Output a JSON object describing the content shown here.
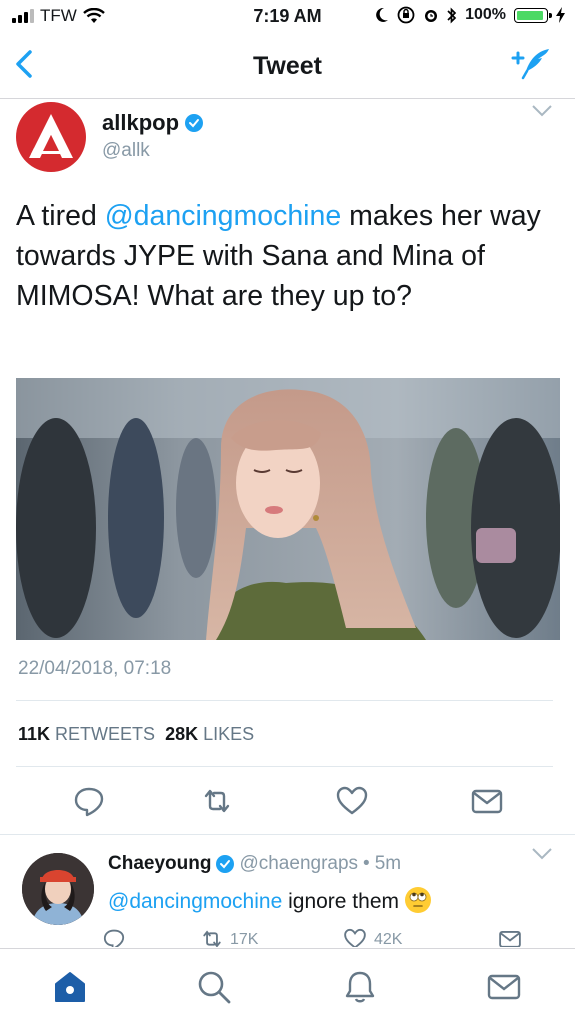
{
  "status_bar": {
    "carrier": "TFW",
    "time": "7:19 AM",
    "battery": "100%"
  },
  "nav": {
    "title": "Tweet"
  },
  "tweet": {
    "author_name": "allkpop",
    "author_handle": "@allk",
    "text_before": "A tired ",
    "mention": "@dancingmochine",
    "text_after": " makes her way towards JYPE with Sana and Mina of MIMOSA! What are they up to?",
    "timestamp": "22/04/2018, 07:18",
    "retweet_count": "11K",
    "retweet_label": "RETWEETS",
    "like_count": "28K",
    "like_label": "LIKES"
  },
  "reply": {
    "author_name": "Chaeyoung",
    "author_handle": "@chaengraps",
    "dot": "•",
    "age": "5m",
    "mention": "@dancingmochine",
    "text": " ignore them",
    "retweet_count": "17K",
    "like_count": "42K"
  },
  "tab_bar": {
    "items": [
      "home-tab",
      "search-tab",
      "notifications-tab",
      "messages-tab"
    ]
  },
  "colors": {
    "accent": "#1da1f2",
    "brand_red": "#d42a2f",
    "muted": "#8899a6",
    "battery": "#4cd964"
  }
}
